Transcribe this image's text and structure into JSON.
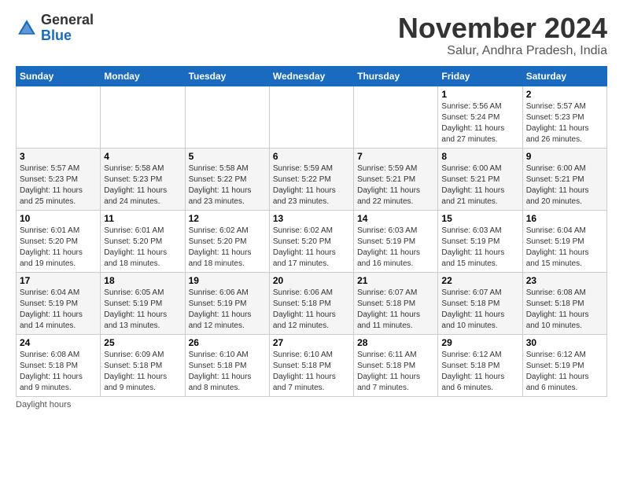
{
  "header": {
    "logo_general": "General",
    "logo_blue": "Blue",
    "month_title": "November 2024",
    "subtitle": "Salur, Andhra Pradesh, India"
  },
  "days_of_week": [
    "Sunday",
    "Monday",
    "Tuesday",
    "Wednesday",
    "Thursday",
    "Friday",
    "Saturday"
  ],
  "weeks": [
    [
      {
        "day": "",
        "info": ""
      },
      {
        "day": "",
        "info": ""
      },
      {
        "day": "",
        "info": ""
      },
      {
        "day": "",
        "info": ""
      },
      {
        "day": "",
        "info": ""
      },
      {
        "day": "1",
        "info": "Sunrise: 5:56 AM\nSunset: 5:24 PM\nDaylight: 11 hours and 27 minutes."
      },
      {
        "day": "2",
        "info": "Sunrise: 5:57 AM\nSunset: 5:23 PM\nDaylight: 11 hours and 26 minutes."
      }
    ],
    [
      {
        "day": "3",
        "info": "Sunrise: 5:57 AM\nSunset: 5:23 PM\nDaylight: 11 hours and 25 minutes."
      },
      {
        "day": "4",
        "info": "Sunrise: 5:58 AM\nSunset: 5:23 PM\nDaylight: 11 hours and 24 minutes."
      },
      {
        "day": "5",
        "info": "Sunrise: 5:58 AM\nSunset: 5:22 PM\nDaylight: 11 hours and 23 minutes."
      },
      {
        "day": "6",
        "info": "Sunrise: 5:59 AM\nSunset: 5:22 PM\nDaylight: 11 hours and 23 minutes."
      },
      {
        "day": "7",
        "info": "Sunrise: 5:59 AM\nSunset: 5:21 PM\nDaylight: 11 hours and 22 minutes."
      },
      {
        "day": "8",
        "info": "Sunrise: 6:00 AM\nSunset: 5:21 PM\nDaylight: 11 hours and 21 minutes."
      },
      {
        "day": "9",
        "info": "Sunrise: 6:00 AM\nSunset: 5:21 PM\nDaylight: 11 hours and 20 minutes."
      }
    ],
    [
      {
        "day": "10",
        "info": "Sunrise: 6:01 AM\nSunset: 5:20 PM\nDaylight: 11 hours and 19 minutes."
      },
      {
        "day": "11",
        "info": "Sunrise: 6:01 AM\nSunset: 5:20 PM\nDaylight: 11 hours and 18 minutes."
      },
      {
        "day": "12",
        "info": "Sunrise: 6:02 AM\nSunset: 5:20 PM\nDaylight: 11 hours and 18 minutes."
      },
      {
        "day": "13",
        "info": "Sunrise: 6:02 AM\nSunset: 5:20 PM\nDaylight: 11 hours and 17 minutes."
      },
      {
        "day": "14",
        "info": "Sunrise: 6:03 AM\nSunset: 5:19 PM\nDaylight: 11 hours and 16 minutes."
      },
      {
        "day": "15",
        "info": "Sunrise: 6:03 AM\nSunset: 5:19 PM\nDaylight: 11 hours and 15 minutes."
      },
      {
        "day": "16",
        "info": "Sunrise: 6:04 AM\nSunset: 5:19 PM\nDaylight: 11 hours and 15 minutes."
      }
    ],
    [
      {
        "day": "17",
        "info": "Sunrise: 6:04 AM\nSunset: 5:19 PM\nDaylight: 11 hours and 14 minutes."
      },
      {
        "day": "18",
        "info": "Sunrise: 6:05 AM\nSunset: 5:19 PM\nDaylight: 11 hours and 13 minutes."
      },
      {
        "day": "19",
        "info": "Sunrise: 6:06 AM\nSunset: 5:19 PM\nDaylight: 11 hours and 12 minutes."
      },
      {
        "day": "20",
        "info": "Sunrise: 6:06 AM\nSunset: 5:18 PM\nDaylight: 11 hours and 12 minutes."
      },
      {
        "day": "21",
        "info": "Sunrise: 6:07 AM\nSunset: 5:18 PM\nDaylight: 11 hours and 11 minutes."
      },
      {
        "day": "22",
        "info": "Sunrise: 6:07 AM\nSunset: 5:18 PM\nDaylight: 11 hours and 10 minutes."
      },
      {
        "day": "23",
        "info": "Sunrise: 6:08 AM\nSunset: 5:18 PM\nDaylight: 11 hours and 10 minutes."
      }
    ],
    [
      {
        "day": "24",
        "info": "Sunrise: 6:08 AM\nSunset: 5:18 PM\nDaylight: 11 hours and 9 minutes."
      },
      {
        "day": "25",
        "info": "Sunrise: 6:09 AM\nSunset: 5:18 PM\nDaylight: 11 hours and 9 minutes."
      },
      {
        "day": "26",
        "info": "Sunrise: 6:10 AM\nSunset: 5:18 PM\nDaylight: 11 hours and 8 minutes."
      },
      {
        "day": "27",
        "info": "Sunrise: 6:10 AM\nSunset: 5:18 PM\nDaylight: 11 hours and 7 minutes."
      },
      {
        "day": "28",
        "info": "Sunrise: 6:11 AM\nSunset: 5:18 PM\nDaylight: 11 hours and 7 minutes."
      },
      {
        "day": "29",
        "info": "Sunrise: 6:12 AM\nSunset: 5:18 PM\nDaylight: 11 hours and 6 minutes."
      },
      {
        "day": "30",
        "info": "Sunrise: 6:12 AM\nSunset: 5:19 PM\nDaylight: 11 hours and 6 minutes."
      }
    ]
  ],
  "footer": {
    "note": "Daylight hours"
  }
}
